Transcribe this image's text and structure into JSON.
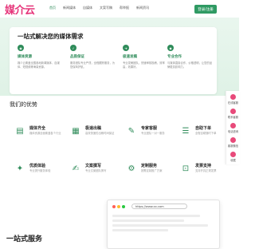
{
  "header": {
    "logo": "媒介云",
    "nav": [
      "首页",
      "新闻媒体",
      "自媒体",
      "文案写稿",
      "帮举报",
      "新闻资讯"
    ],
    "login_label": "登录/注册"
  },
  "hero": {
    "title": "一站式解决您的媒体需求",
    "features": [
      {
        "title": "媒体资源",
        "desc": "媒介云覆盖全国各地新闻媒体、自媒体、短视频等海量资源。"
      },
      {
        "title": "品质保证",
        "desc": "服务团队专业严谨，全程跟踪服务，为您保驾护航。"
      },
      {
        "title": "极速发稿",
        "desc": "专业发稿团队，快速审核投稿，效率高，效果好。"
      },
      {
        "title": "专业合作",
        "desc": "与媒体直接合作，价格透明，让您的品牌更具影响力。"
      }
    ]
  },
  "sidebar": [
    "在线客服",
    "联系客服",
    "电话咨询",
    "客服微信",
    "收藏"
  ],
  "advantages": {
    "title": "我们的优势",
    "items": [
      {
        "title": "媒体齐全",
        "desc": "媒体资源全面覆盖各个行业"
      },
      {
        "title": "极速出稿",
        "desc": "高效快速的出稿时间保证"
      },
      {
        "title": "专家客服",
        "desc": "专业团队一对一服务"
      },
      {
        "title": "自助下单",
        "desc": "全程自助随时下单"
      },
      {
        "title": "优质体验",
        "desc": "专业提升服务体验"
      },
      {
        "title": "文案撰写",
        "desc": "专业文案团队撰写"
      },
      {
        "title": "定制服务",
        "desc": "按需定制推广方案"
      },
      {
        "title": "发票支持",
        "desc": "支持开具正规发票"
      }
    ]
  },
  "browser": {
    "url": "https://www.xx.com"
  },
  "bottom_title": "一站式服务"
}
